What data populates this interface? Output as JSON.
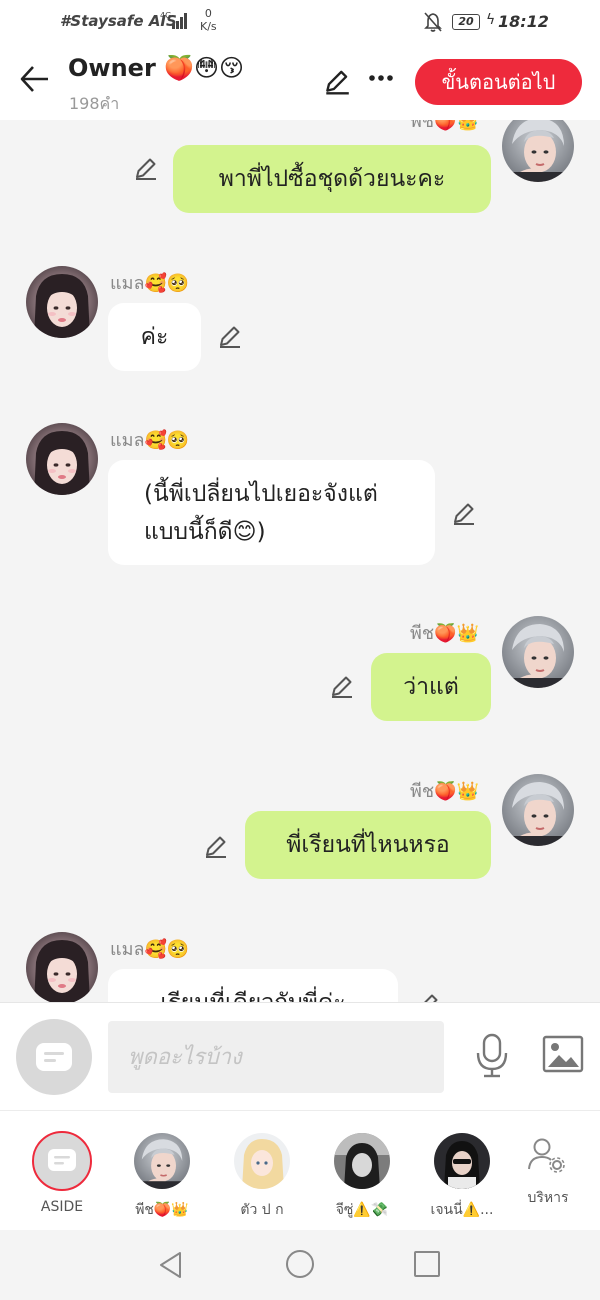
{
  "status_bar": {
    "carrier": "#Staysafe AIS",
    "network": "4G",
    "speed_value": "0",
    "speed_unit": "K/s",
    "battery": "20",
    "time": "18:12"
  },
  "header": {
    "title": "Owner 🍑😳😚",
    "subtitle": "198คำ",
    "next_button": "ขั้นตอนต่อไป"
  },
  "messages": [
    {
      "sender": "พีช🍑👑",
      "text": "พาพี่ไปซื้อชุดด้วยนะคะ",
      "mine": true
    },
    {
      "sender": "แมล🥰🥺",
      "text": "ค่ะ",
      "mine": false
    },
    {
      "sender": "แมล🥰🥺",
      "text": "(นี้พี่เปลี่ยนไปเยอะจังแต่แบบนี้ก็ดี😊)",
      "mine": false
    },
    {
      "sender": "พีช🍑👑",
      "text": "ว่าแต่",
      "mine": true
    },
    {
      "sender": "พีช🍑👑",
      "text": "พี่เรียนที่ไหนหรอ",
      "mine": true
    },
    {
      "sender": "แมล🥰🥺",
      "text": "เรียนที่เดียวกับพี่ค่ะ",
      "mine": false
    }
  ],
  "input": {
    "placeholder": "พูดอะไรบ้าง"
  },
  "tabs": [
    {
      "label": "ASIDE",
      "icon": "chat-bubble-icon"
    },
    {
      "label": "พีช🍑👑",
      "icon": "avatar"
    },
    {
      "label": "ตัว ป ก",
      "icon": "avatar"
    },
    {
      "label": "จีซู่⚠️💸",
      "icon": "avatar"
    },
    {
      "label": "เจนนี่⚠️...",
      "icon": "avatar"
    },
    {
      "label": "บริหาร",
      "icon": "user-gear-icon"
    }
  ],
  "colors": {
    "accent": "#ee2a3c",
    "my_bubble": "#d3f38e",
    "their_bubble": "#ffffff",
    "background": "#f4f4f4"
  }
}
